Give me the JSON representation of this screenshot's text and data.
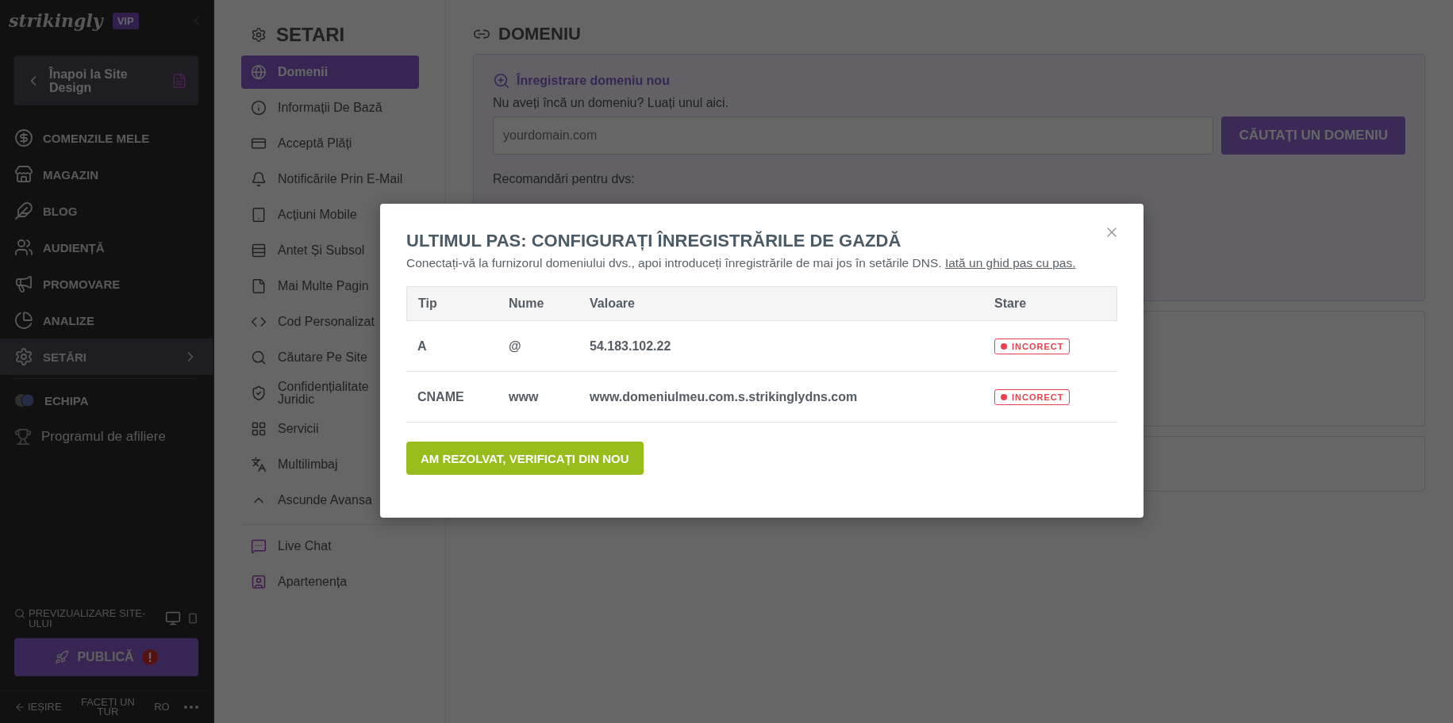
{
  "sidebar": {
    "logo": "strikingly",
    "badge": "VIP",
    "back_button": "Înapoi la Site Design",
    "items": [
      {
        "label": "COMENZILE MELE",
        "selected": false
      },
      {
        "label": "MAGAZIN",
        "selected": false
      },
      {
        "label": "BLOG",
        "selected": false
      },
      {
        "label": "AUDIENȚĂ",
        "selected": false
      },
      {
        "label": "PROMOVARE",
        "selected": false
      },
      {
        "label": "ANALIZE",
        "selected": false
      },
      {
        "label": "SETĂRI",
        "selected": true
      }
    ],
    "extra": [
      {
        "label": "ECHIPA",
        "kind": "team"
      },
      {
        "label": "Programul de afiliere",
        "kind": "affiliate"
      }
    ],
    "preview": "PREVIZUALIZARE SITE-ULUI",
    "publish": "PUBLICĂ",
    "exit": "IEȘIRE",
    "tour": "FACEȚI UN TUR",
    "language": "RO"
  },
  "settings": {
    "title": "SETARI",
    "items": [
      {
        "label": "Domenii",
        "selected": true
      },
      {
        "label": "Informații De Bază",
        "selected": false
      },
      {
        "label": "Acceptă Plăți",
        "selected": false
      },
      {
        "label": "Notificările Prin E-Mail",
        "selected": false
      },
      {
        "label": "Acțiuni Mobile",
        "selected": false
      },
      {
        "label": "Antet Și Subsol",
        "selected": false
      },
      {
        "label": "Mai Multe Pagin",
        "selected": false
      },
      {
        "label": "Cod Personalizat",
        "selected": false
      },
      {
        "label": "Căutare Pe Site",
        "selected": false
      },
      {
        "label": "Confidențialitate Juridic",
        "selected": false
      },
      {
        "label": "Servicii",
        "selected": false
      },
      {
        "label": "Multilimbaj",
        "selected": false
      },
      {
        "label": "Ascunde Avansa",
        "selected": false
      }
    ],
    "extra": [
      "Live Chat",
      "Apartenența"
    ]
  },
  "domain": {
    "title": "DOMENIU",
    "card": {
      "heading": "Înregistrare domeniu nou",
      "text": "Nu aveți încă un domeniu? Luați unul aici.",
      "placeholder": "yourdomain.com",
      "button": "CĂUTAȚI UN DOMENIU",
      "recommendations": "Recomandări pentru dvs:"
    }
  },
  "modal": {
    "title": "ULTIMUL PAS: CONFIGURAȚI ÎNREGISTRĂRILE DE GAZDĂ",
    "description": "Conectați-vă la furnizorul domeniului dvs., apoi introduceți înregistrările de mai jos în setările DNS.",
    "link": "Iată un ghid pas cu pas.",
    "columns": [
      "Tip",
      "Nume",
      "Valoare",
      "Stare"
    ],
    "rows": [
      {
        "type": "A",
        "name": "@",
        "value": "54.183.102.22",
        "status": "INCORECT",
        "color": "#e8414f"
      },
      {
        "type": "CNAME",
        "name": "www",
        "value": "www.domeniulmeu.com.s.strikinglydns.com",
        "status": "INCORECT",
        "color": "#e8414f"
      }
    ],
    "button": "AM REZOLVAT, VERIFICAȚI DIN NOU"
  }
}
